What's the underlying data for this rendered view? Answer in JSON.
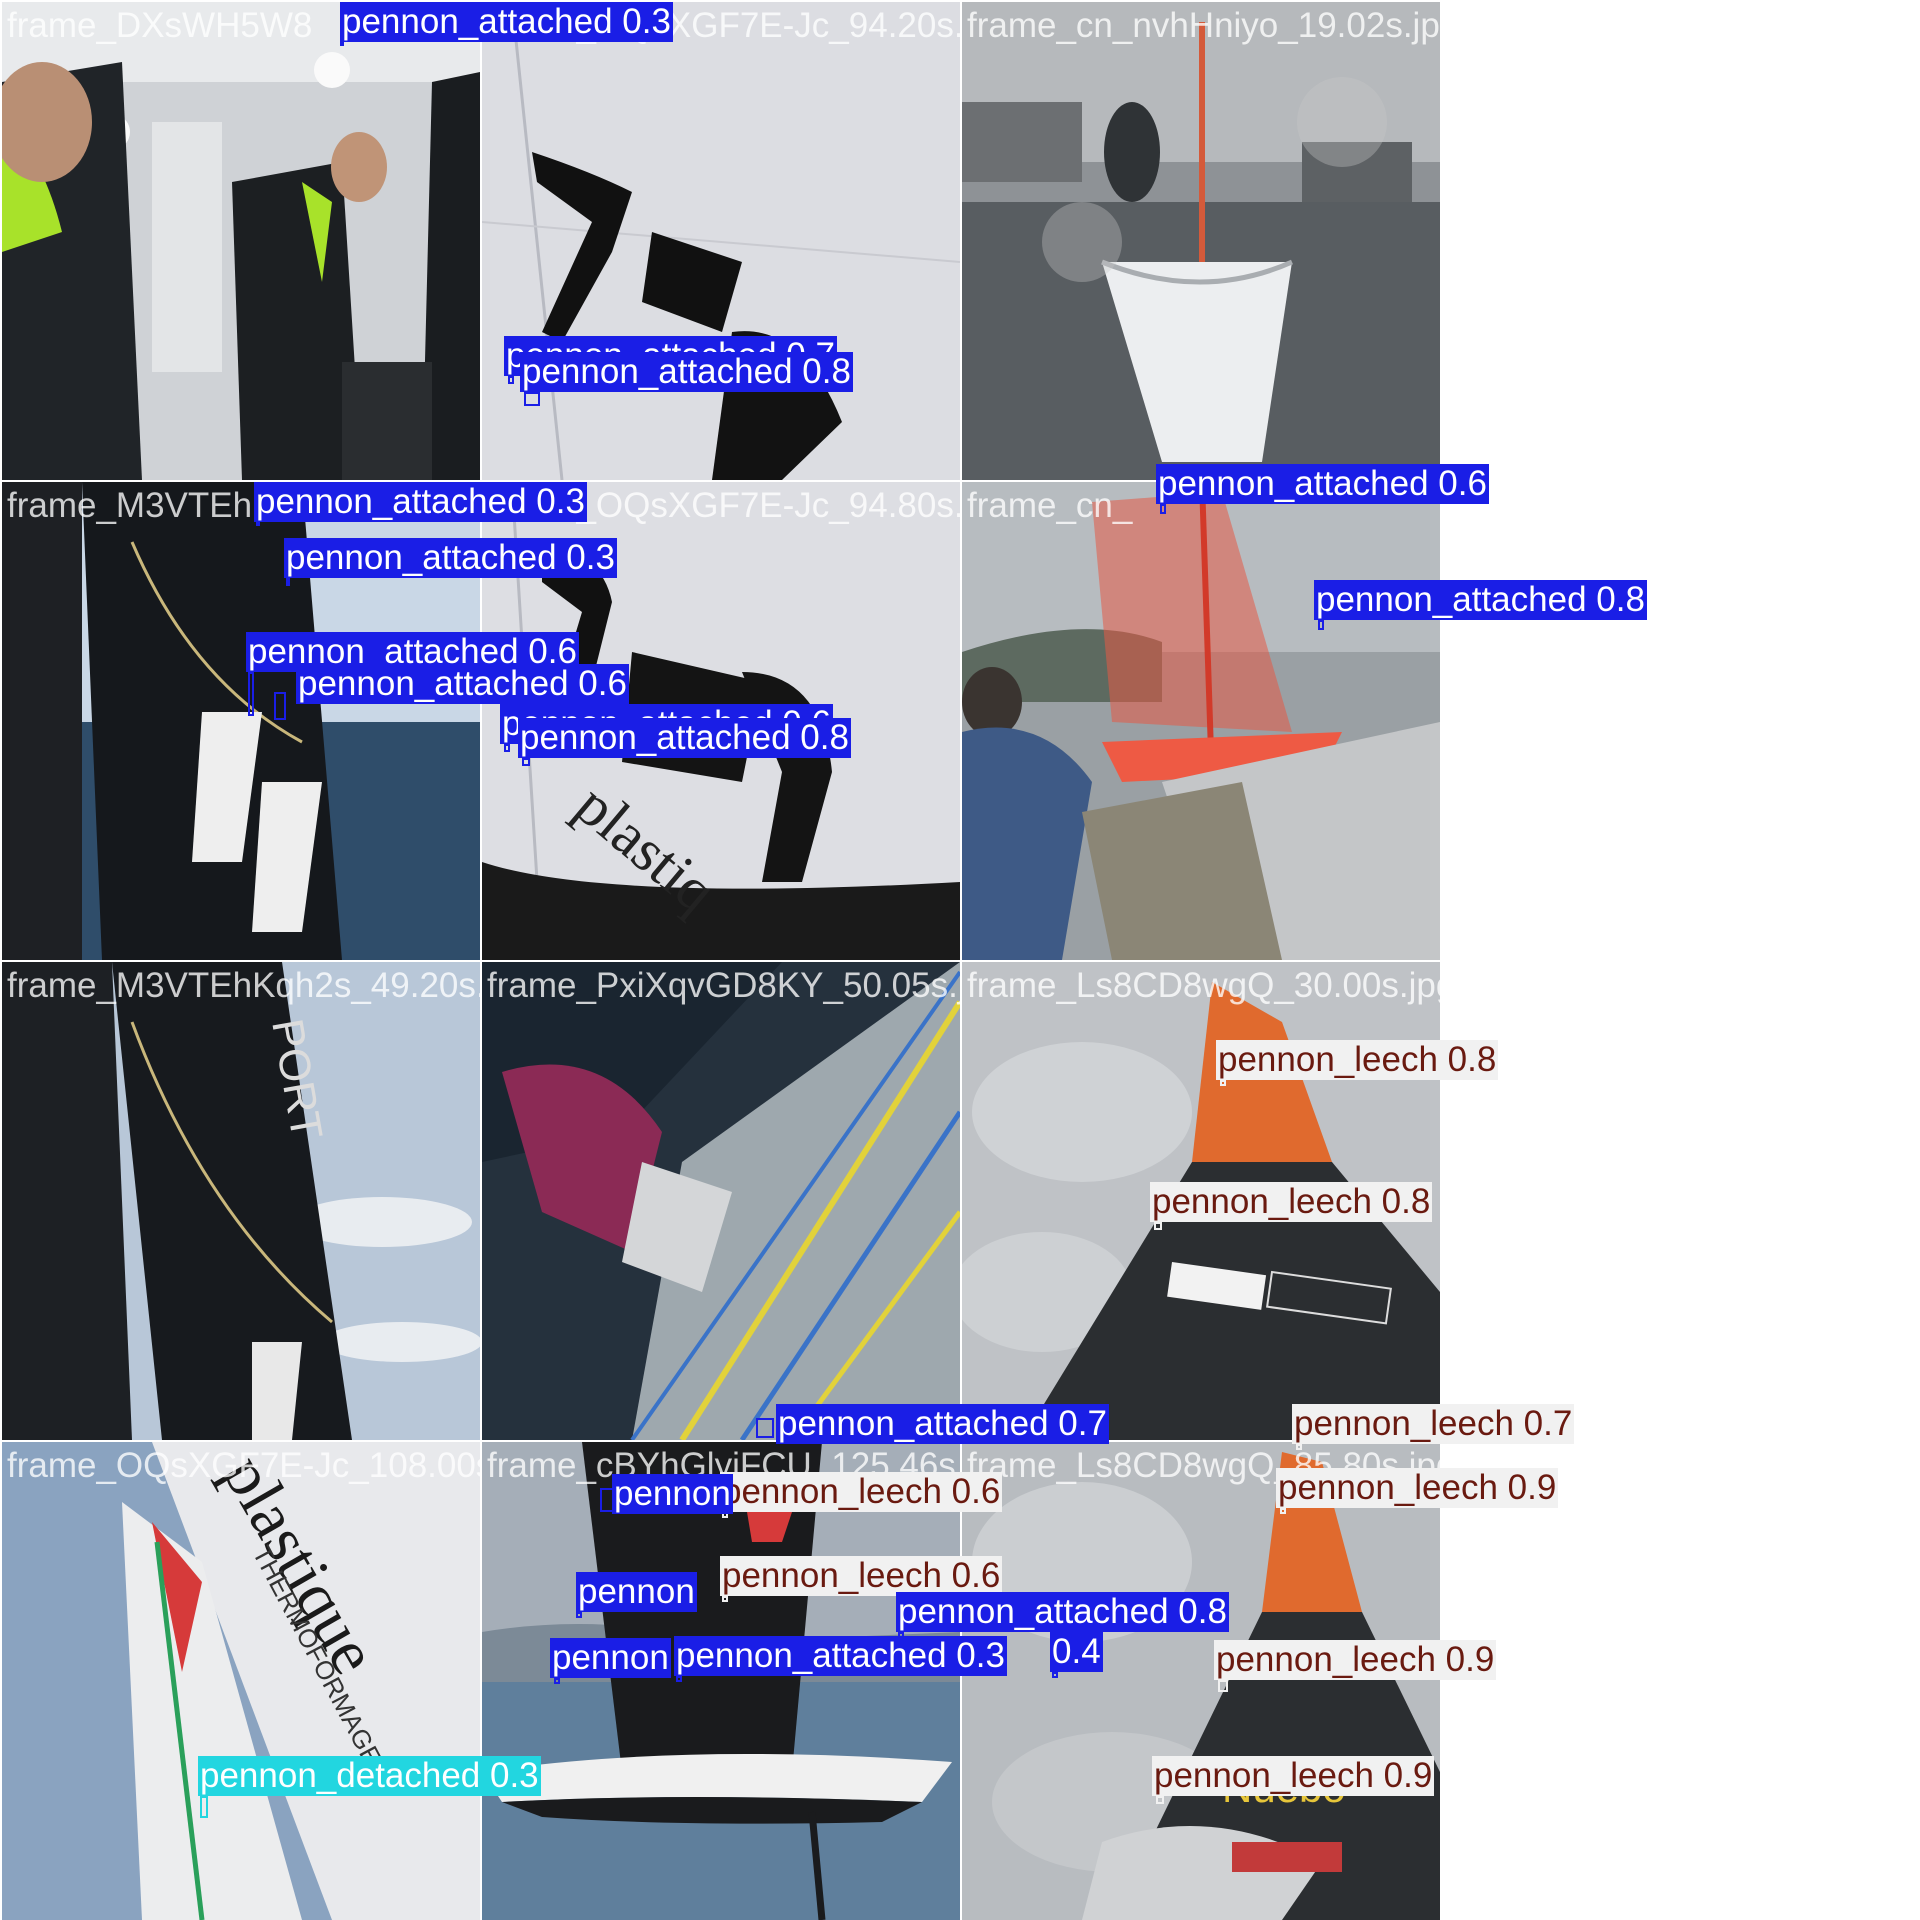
{
  "colors": {
    "pennon_attached": "#1a1ee6",
    "pennon_leech": "#f1f1f1",
    "pennon_leech_text": "#6a1a10",
    "pennon_detached": "#22d6e0"
  },
  "tiles": [
    {
      "filename": "frame_DXsWH5W8",
      "scene": "cabin-crew"
    },
    {
      "filename": "frame_OQsXGF7E-Jc_94.20s.jpg",
      "scene": "white-sail"
    },
    {
      "filename": "frame_cn_nvhHniyo_19.02s.jpg",
      "scene": "harbour-boat"
    },
    {
      "filename": "frame_M3VTEh",
      "scene": "dark-sail-sea"
    },
    {
      "filename": "frame_OQsXGF7E-Jc_94.80s.jpg",
      "scene": "white-sail"
    },
    {
      "filename": "frame_cn_",
      "scene": "dinghy-red-sail"
    },
    {
      "filename": "frame_M3VTEhKqh2s_49.20s.jpg",
      "scene": "dark-sail-sky"
    },
    {
      "filename": "frame_PxiXqvGD8KY_50.05s.jpg",
      "scene": "foil-sail"
    },
    {
      "filename": "frame_Ls8CD8wgQ_30.00s.jpg",
      "scene": "orange-sail"
    },
    {
      "filename": "frame_OQsXGF7E-Jc_108.00s.jpg",
      "scene": "plastique-sail"
    },
    {
      "filename": "frame_cBYhGlyiFCU_125.46s.jpg",
      "scene": "britannia-boat"
    },
    {
      "filename": "frame_Ls8CD8wgQ_85.80s.jpg",
      "scene": "orange-sail-2"
    }
  ],
  "detections": [
    {
      "label": "pennon_attached 0.3",
      "cls": "attached"
    },
    {
      "label": "pennon_attached 0.7",
      "cls": "attached"
    },
    {
      "label": "pennon_attached 0.8",
      "cls": "attached"
    },
    {
      "label": "pennon_attached 0.3",
      "cls": "attached"
    },
    {
      "label": "pennon_attached 0.3",
      "cls": "attached"
    },
    {
      "label": "pennon_attached 0.6",
      "cls": "attached"
    },
    {
      "label": "pennon_attached 0.6",
      "cls": "attached"
    },
    {
      "label": "pennon_attached 0.6",
      "cls": "attached"
    },
    {
      "label": "pennon_attached 0.8",
      "cls": "attached"
    },
    {
      "label": "pennon_attached 0.6",
      "cls": "attached"
    },
    {
      "label": "pennon_attached 0.8",
      "cls": "attached"
    },
    {
      "label": "pennon_leech 0.8",
      "cls": "leech"
    },
    {
      "label": "pennon_leech 0.8",
      "cls": "leech"
    },
    {
      "label": "pennon_attached 0.7",
      "cls": "attached"
    },
    {
      "label": "pennon_leech 0.7",
      "cls": "leech"
    },
    {
      "label": "pennon_leech 0.9",
      "cls": "leech"
    },
    {
      "label": "pennon_leech 0.6",
      "cls": "leech"
    },
    {
      "label": "pennon_leech 0.6",
      "cls": "leech"
    },
    {
      "label": "pennon_attached 0.8",
      "cls": "attached"
    },
    {
      "label": "pennon_attached 0.3",
      "cls": "attached"
    },
    {
      "label": "0.4",
      "cls": "attached"
    },
    {
      "label": "pennon_leech 0.9",
      "cls": "leech"
    },
    {
      "label": "pennon_leech 0.9",
      "cls": "leech"
    },
    {
      "label": "pennon_detached 0.3",
      "cls": "detached"
    },
    {
      "label": "pennon",
      "cls": "attached"
    },
    {
      "label": "pennon",
      "cls": "attached"
    },
    {
      "label": "pennon",
      "cls": "attached"
    }
  ]
}
